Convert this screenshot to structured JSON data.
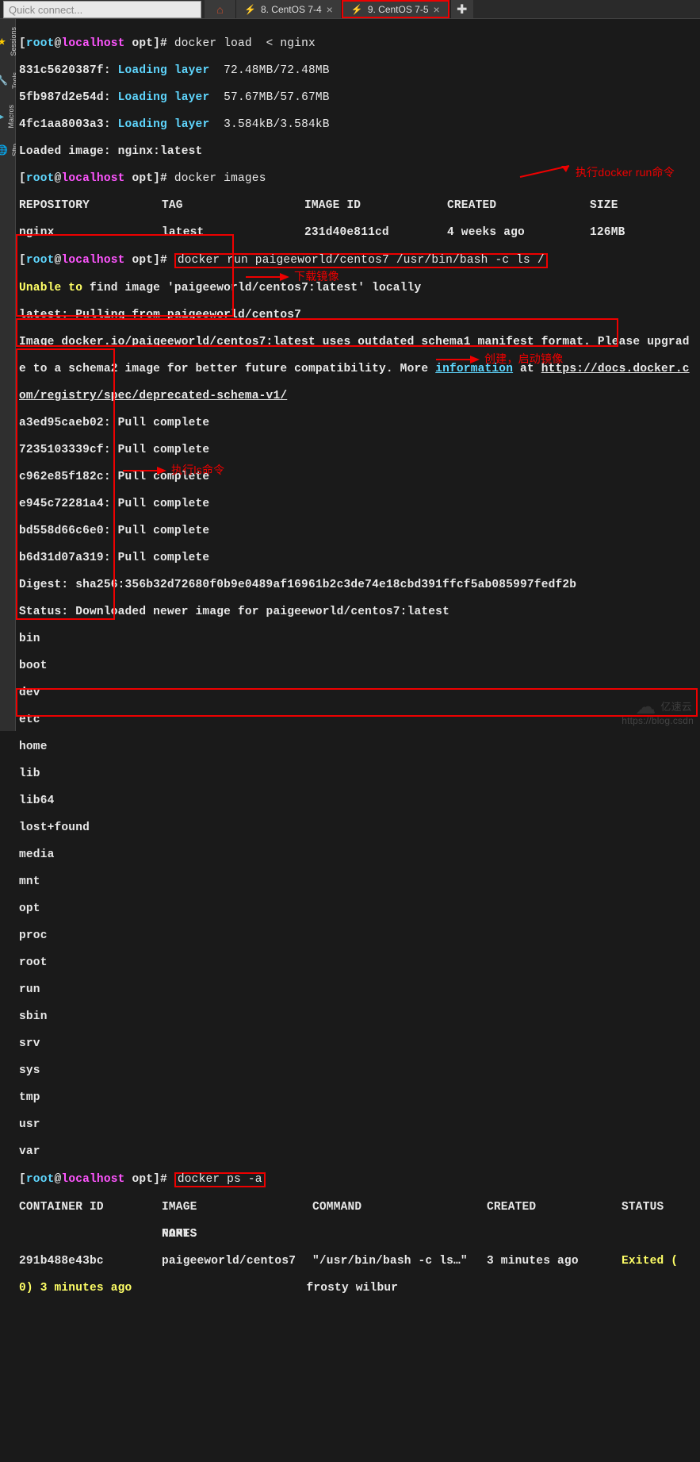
{
  "topbar": {
    "quick_connect_placeholder": "Quick connect...",
    "tabs": [
      {
        "label": "8. CentOS 7-4",
        "close": "×"
      },
      {
        "label": "9. CentOS 7-5",
        "close": "×"
      }
    ],
    "newtab": "✚"
  },
  "sidebar": {
    "items": [
      "Sessions",
      "Tools",
      "Macros",
      "Sftp"
    ]
  },
  "prompt": {
    "open": "[",
    "user": "root",
    "at": "@",
    "host": "localhost",
    "path": " opt",
    "close": "]# "
  },
  "cmds": {
    "load": "docker load  < nginx",
    "images": "docker images",
    "run": "docker run paigeeworld/centos7 /usr/bin/bash -c ls /",
    "psa": "docker ps -a"
  },
  "load_layers": [
    {
      "id": "831c5620387f:",
      "action": "Loading layer",
      "size": "72.48MB/72.48MB"
    },
    {
      "id": "5fb987d2e54d:",
      "action": "Loading layer",
      "size": "57.67MB/57.67MB"
    },
    {
      "id": "4fc1aa8003a3:",
      "action": "Loading layer",
      "size": "3.584kB/3.584kB"
    }
  ],
  "loaded_image": "Loaded image: nginx:latest",
  "images_hdr": {
    "repo": "REPOSITORY",
    "tag": "TAG",
    "id": "IMAGE ID",
    "created": "CREATED",
    "size": "SIZE"
  },
  "images_row": {
    "repo": "nginx",
    "tag": "latest",
    "id": "231d40e811cd",
    "created": "4 weeks ago",
    "size": "126MB"
  },
  "unable": {
    "pre": "Unable to",
    "post": " find image 'paigeeworld/centos7:latest' locally"
  },
  "pulling": "latest: Pulling from paigeeworld/centos7",
  "deprecated_1": "Image docker.io/paigeeworld/centos7:latest uses outdated schema1 manifest format. Please upgrad",
  "deprecated_2a": "e to a schema2 image for better future compatibility. More ",
  "deprecated_info": "information",
  "deprecated_2b": " at ",
  "deprecated_url1": "https://docs.docker.c",
  "deprecated_url2": "om/registry/spec/deprecated-schema-v1/",
  "pulls": [
    "a3ed95caeb02: Pull complete",
    "7235103339cf: Pull complete",
    "c962e85f182c: Pull complete",
    "e945c72281a4: Pull complete",
    "bd558d66c6e0: Pull complete",
    "b6d31d07a319: Pull complete"
  ],
  "digest": "Digest: sha256:356b32d72680f0b9e0489af16961b2c3de74e18cbd391ffcf5ab085997fedf2b",
  "status": "Status: Downloaded newer image for paigeeworld/centos7:latest",
  "ls_out": [
    "bin",
    "boot",
    "dev",
    "etc",
    "home",
    "lib",
    "lib64",
    "lost+found",
    "media",
    "mnt",
    "opt",
    "proc",
    "root",
    "run",
    "sbin",
    "srv",
    "sys",
    "tmp",
    "usr",
    "var"
  ],
  "ps": {
    "hdr": {
      "cid": "CONTAINER ID",
      "img": "IMAGE",
      "cmd": "COMMAND",
      "created": "CREATED",
      "status": "STATUS",
      "ports": "PORTS",
      "names": "NAMES"
    },
    "row": {
      "cid": "291b488e43bc",
      "img": "paigeeworld/centos7",
      "cmd": "\"/usr/bin/bash -c ls…\"",
      "created": "3 minutes ago",
      "status": "Exited (",
      "status2": "0) 3 minutes ago",
      "names": "frosty wilbur"
    }
  },
  "annotations": {
    "run": "执行docker run命令",
    "download": "下载镜像",
    "create": "创建，启动镜像",
    "ls": "执行ls命令"
  },
  "watermark": "亿速云",
  "foot": "https://blog.csdn"
}
